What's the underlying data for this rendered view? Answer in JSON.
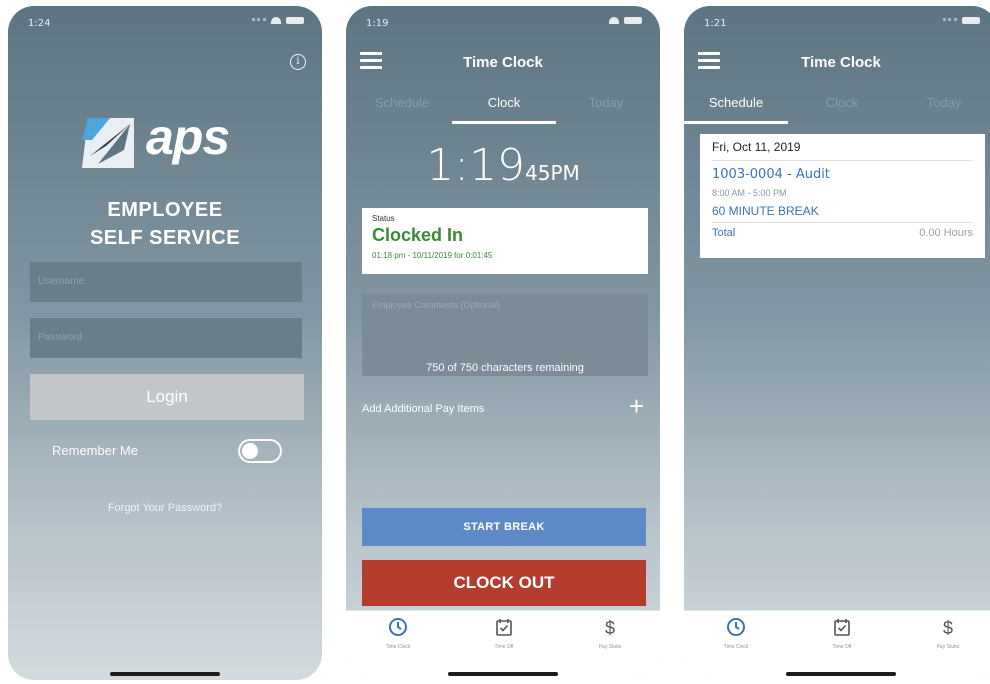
{
  "colors": {
    "bg_top": "#5d7482",
    "bg_bottom": "#d4dbdf",
    "clocked_in_green": "#3a8a37",
    "start_break_blue": "#5d8ac6",
    "clock_out_red": "#b53d2f",
    "link_blue": "#3c72b6",
    "nav_icon_blue": "#3c72b6"
  },
  "screen1": {
    "status_time": "1:24",
    "logo_text": "aps",
    "title_line1": "EMPLOYEE",
    "title_line2": "SELF SERVICE",
    "username_placeholder": "Username",
    "password_placeholder": "Password",
    "login_label": "Login",
    "remember_label": "Remember Me",
    "remember_on": false,
    "forgot_label": "Forgot Your Password?"
  },
  "screen2": {
    "status_time": "1:19",
    "title": "Time Clock",
    "tabs": [
      "Schedule",
      "Clock",
      "Today"
    ],
    "active_tab": "Clock",
    "clock_time": "1:19",
    "clock_seconds": "45PM",
    "status_label": "Status",
    "status_value": "Clocked In",
    "status_detail": "01:18 pm - 10/11/2019 for 0:01:45",
    "comments_placeholder": "Employee Comments (Optional)",
    "chars_remaining": "750 of 750 characters remaining",
    "pay_items_label": "Add Additional Pay Items",
    "start_break_label": "START BREAK",
    "clock_out_label": "CLOCK OUT",
    "nav": [
      "Time Clock",
      "Time Off",
      "Pay Stubs"
    ]
  },
  "screen3": {
    "status_time": "1:21",
    "title": "Time Clock",
    "tabs": [
      "Schedule",
      "Clock",
      "Today"
    ],
    "active_tab": "Schedule",
    "date": "Fri, Oct 11, 2019",
    "job": "1003-0004 - Audit",
    "shift": "8:00 AM - 5:00 PM",
    "break_label": "60 MINUTE BREAK",
    "total_label": "Total",
    "total_hours": "0.00 Hours",
    "nav": [
      "Time Clock",
      "Time Off",
      "Pay Stubs"
    ]
  }
}
